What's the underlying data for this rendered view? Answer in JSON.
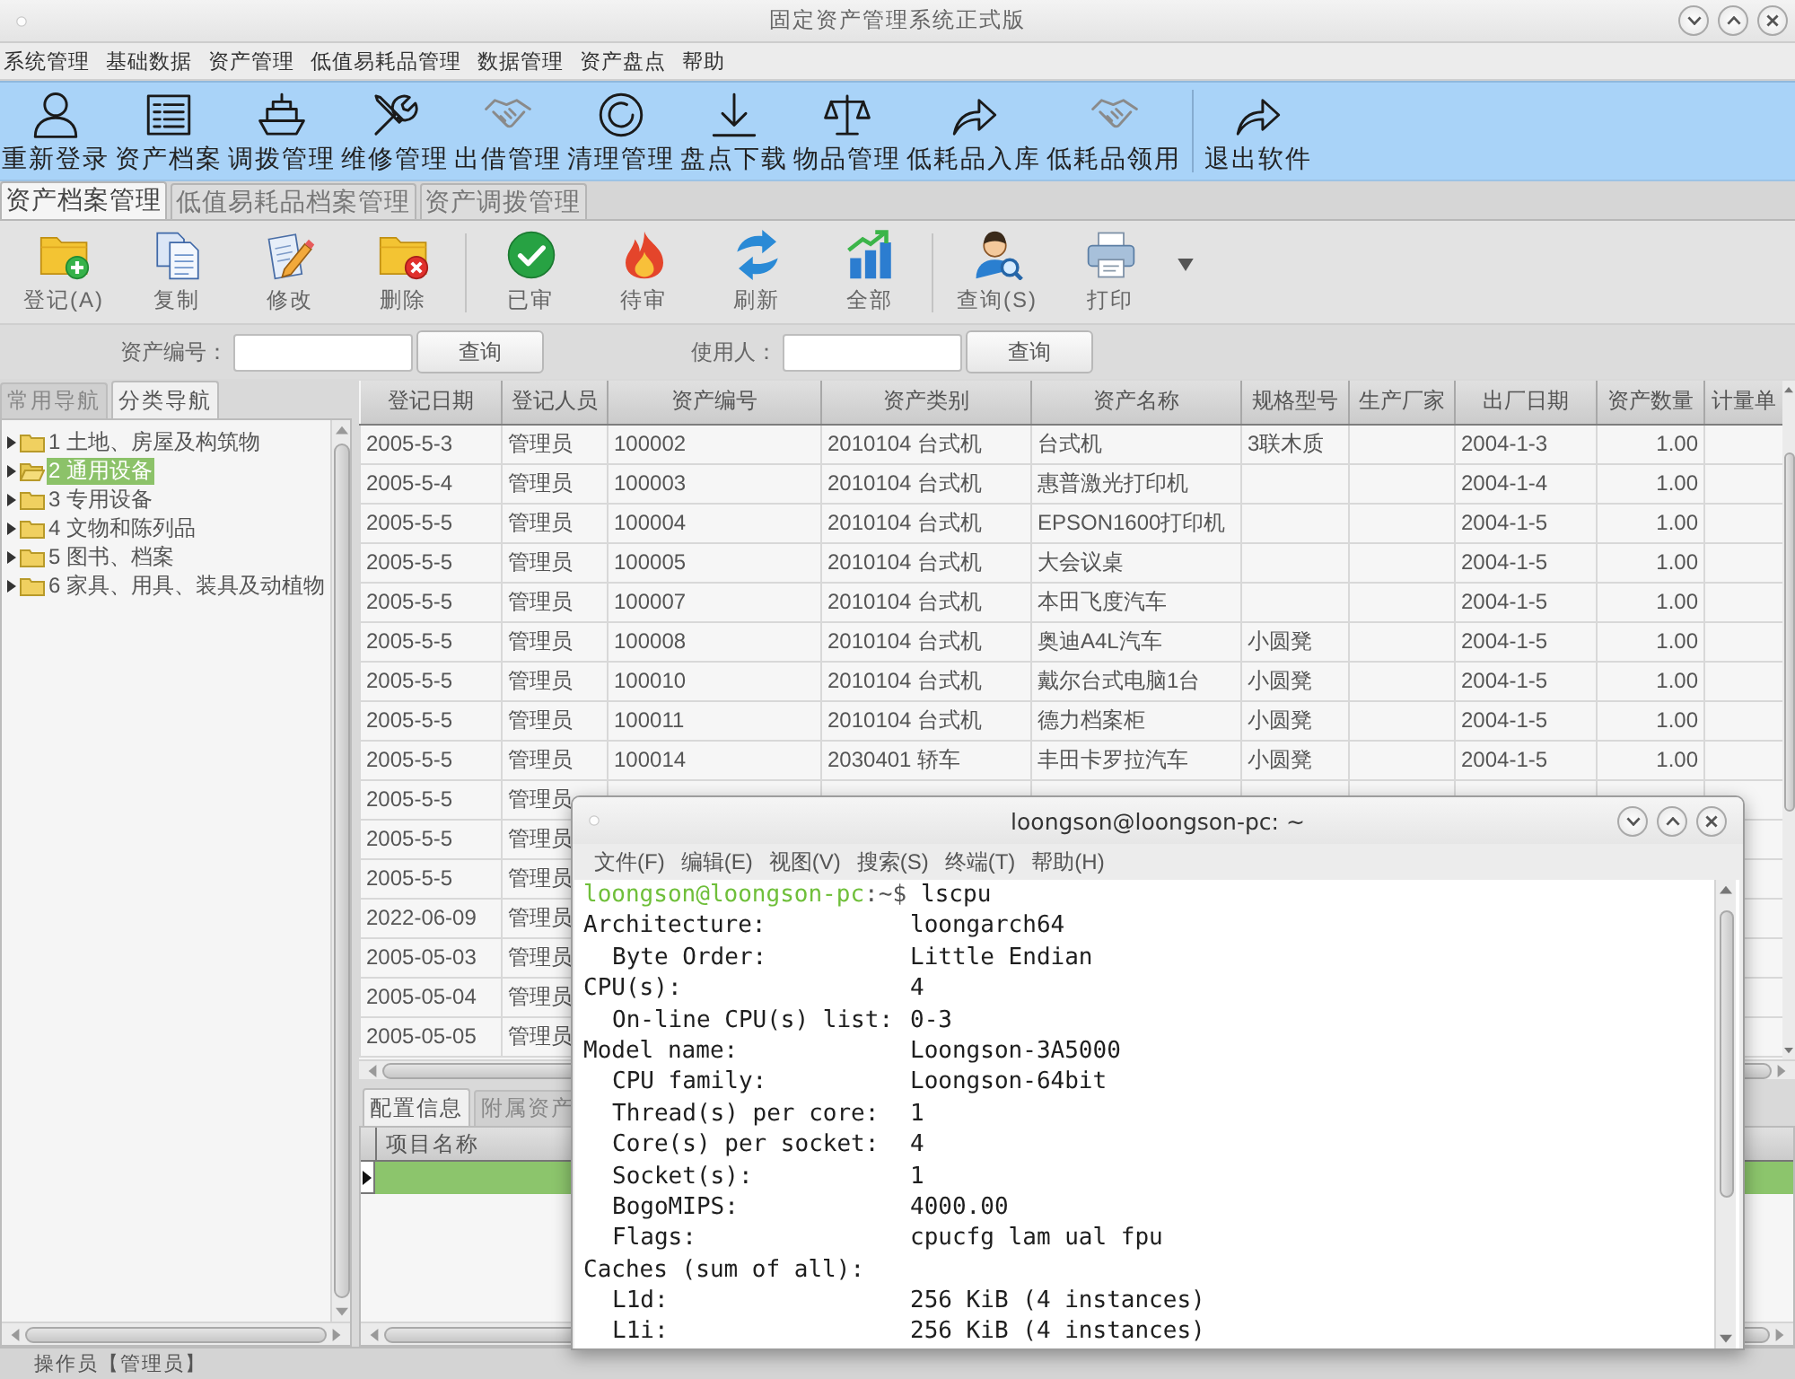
{
  "window": {
    "title": "固定资产管理系统正式版"
  },
  "menu": [
    "系统管理",
    "基础数据",
    "资产管理",
    "低值易耗品管理",
    "数据管理",
    "资产盘点",
    "帮助"
  ],
  "toolbar": [
    [
      "重新登录",
      "资产档案",
      "调拨管理",
      "维修管理",
      "出借管理",
      "清理管理",
      "盘点下载",
      "物品管理",
      "低耗品入库",
      "低耗品领用"
    ],
    [
      "退出软件"
    ]
  ],
  "tabs": [
    {
      "label": "资产档案管理",
      "selected": true
    },
    {
      "label": "低值易耗品档案管理",
      "selected": false
    },
    {
      "label": "资产调拨管理",
      "selected": false
    }
  ],
  "actions": [
    [
      "登记(A)",
      "复制",
      "修改",
      "删除"
    ],
    [
      "已审",
      "待审",
      "刷新",
      "全部"
    ],
    [
      "查询(S)",
      "打印"
    ]
  ],
  "search": [
    {
      "label": "资产编号：",
      "button": "查询"
    },
    {
      "label": "使用人：",
      "button": "查询"
    }
  ],
  "nav": {
    "tabs": [
      {
        "label": "常用导航",
        "selected": false
      },
      {
        "label": "分类导航",
        "selected": true
      }
    ],
    "items": [
      {
        "label": "1 土地、房屋及构筑物",
        "expanded": false,
        "selected": false
      },
      {
        "label": "2 通用设备",
        "expanded": false,
        "selected": true
      },
      {
        "label": "3 专用设备",
        "expanded": false,
        "selected": false
      },
      {
        "label": "4 文物和陈列品",
        "expanded": false,
        "selected": false
      },
      {
        "label": "5 图书、档案",
        "expanded": false,
        "selected": false
      },
      {
        "label": "6 家具、用具、装具及动植物",
        "expanded": false,
        "selected": false
      }
    ]
  },
  "table": {
    "columns": [
      "登记日期",
      "登记人员",
      "资产编号",
      "资产类别",
      "资产名称",
      "规格型号",
      "生产厂家",
      "出厂日期",
      "资产数量",
      "计量单"
    ],
    "rows": [
      {
        "register_date": "2005-5-3",
        "registrar": "管理员",
        "asset_no": "100002",
        "category": "2010104 台式机",
        "asset_name": "台式机",
        "spec": "3联木质",
        "factory_date": "2004-1-3",
        "quantity": "1.00"
      },
      {
        "register_date": "2005-5-4",
        "registrar": "管理员",
        "asset_no": "100003",
        "category": "2010104 台式机",
        "asset_name": "惠普激光打印机",
        "factory_date": "2004-1-4",
        "quantity": "1.00"
      },
      {
        "register_date": "2005-5-5",
        "registrar": "管理员",
        "asset_no": "100004",
        "category": "2010104 台式机",
        "asset_name": "EPSON1600打印机",
        "factory_date": "2004-1-5",
        "quantity": "1.00"
      },
      {
        "register_date": "2005-5-5",
        "registrar": "管理员",
        "asset_no": "100005",
        "category": "2010104 台式机",
        "asset_name": "大会议桌",
        "factory_date": "2004-1-5",
        "quantity": "1.00"
      },
      {
        "register_date": "2005-5-5",
        "registrar": "管理员",
        "asset_no": "100007",
        "category": "2010104 台式机",
        "asset_name": "本田飞度汽车",
        "factory_date": "2004-1-5",
        "quantity": "1.00"
      },
      {
        "register_date": "2005-5-5",
        "registrar": "管理员",
        "asset_no": "100008",
        "category": "2010104 台式机",
        "asset_name": "奥迪A4L汽车",
        "spec": "小圆凳",
        "factory_date": "2004-1-5",
        "quantity": "1.00"
      },
      {
        "register_date": "2005-5-5",
        "registrar": "管理员",
        "asset_no": "100010",
        "category": "2010104 台式机",
        "asset_name": "戴尔台式电脑1台",
        "spec": "小圆凳",
        "factory_date": "2004-1-5",
        "quantity": "1.00"
      },
      {
        "register_date": "2005-5-5",
        "registrar": "管理员",
        "asset_no": "100011",
        "category": "2010104 台式机",
        "asset_name": "德力档案柜",
        "spec": "小圆凳",
        "factory_date": "2004-1-5",
        "quantity": "1.00"
      },
      {
        "register_date": "2005-5-5",
        "registrar": "管理员",
        "asset_no": "100014",
        "category": "2030401 轿车",
        "asset_name": "丰田卡罗拉汽车",
        "spec": "小圆凳",
        "factory_date": "2004-1-5",
        "quantity": "1.00"
      },
      {
        "register_date": "2005-5-5",
        "registrar": "管理员"
      },
      {
        "register_date": "2005-5-5",
        "registrar": "管理员"
      },
      {
        "register_date": "2005-5-5",
        "registrar": "管理员"
      },
      {
        "register_date": "2022-06-09",
        "registrar": "管理员"
      },
      {
        "register_date": "2005-05-03",
        "registrar": "管理员"
      },
      {
        "register_date": "2005-05-04",
        "registrar": "管理员"
      },
      {
        "register_date": "2005-05-05",
        "registrar": "管理员"
      }
    ]
  },
  "detail": {
    "tabs": [
      {
        "label": "配置信息",
        "selected": true
      },
      {
        "label": "附属资产",
        "selected": false
      }
    ],
    "columns": [
      "项目名称"
    ],
    "rows": [
      {
        "selected": true
      }
    ]
  },
  "status_bar": "操作员【管理员】",
  "terminal": {
    "title": "loongson@loongson-pc: ~",
    "menu": [
      "文件(F)",
      "编辑(E)",
      "视图(V)",
      "搜索(S)",
      "终端(T)",
      "帮助(H)"
    ],
    "prompt": {
      "user_host": "loongson@loongson-pc",
      "symbol": ":~$",
      "command": "lscpu"
    },
    "output": [
      {
        "label": "Architecture:",
        "value": "loongarch64",
        "children": [
          {
            "label": "Byte Order:",
            "value": "Little Endian"
          }
        ]
      },
      {
        "label": "CPU(s):",
        "value": "4",
        "children": [
          {
            "label": "On-line CPU(s) list:",
            "value": "0-3"
          }
        ]
      },
      {
        "label": "Model name:",
        "value": "Loongson-3A5000",
        "children": [
          {
            "label": "CPU family:",
            "value": "Loongson-64bit"
          },
          {
            "label": "Thread(s) per core:",
            "value": "1"
          },
          {
            "label": "Core(s) per socket:",
            "value": "4"
          },
          {
            "label": "Socket(s):",
            "value": "1"
          },
          {
            "label": "BogoMIPS:",
            "value": "4000.00"
          },
          {
            "label": "Flags:",
            "value": "cpucfg lam ual fpu"
          }
        ]
      },
      {
        "label": "Caches (sum of all):",
        "children": [
          {
            "label": "L1d:",
            "value": "256 KiB (4 instances)"
          },
          {
            "label": "L1i:",
            "value": "256 KiB (4 instances)"
          }
        ]
      }
    ]
  }
}
